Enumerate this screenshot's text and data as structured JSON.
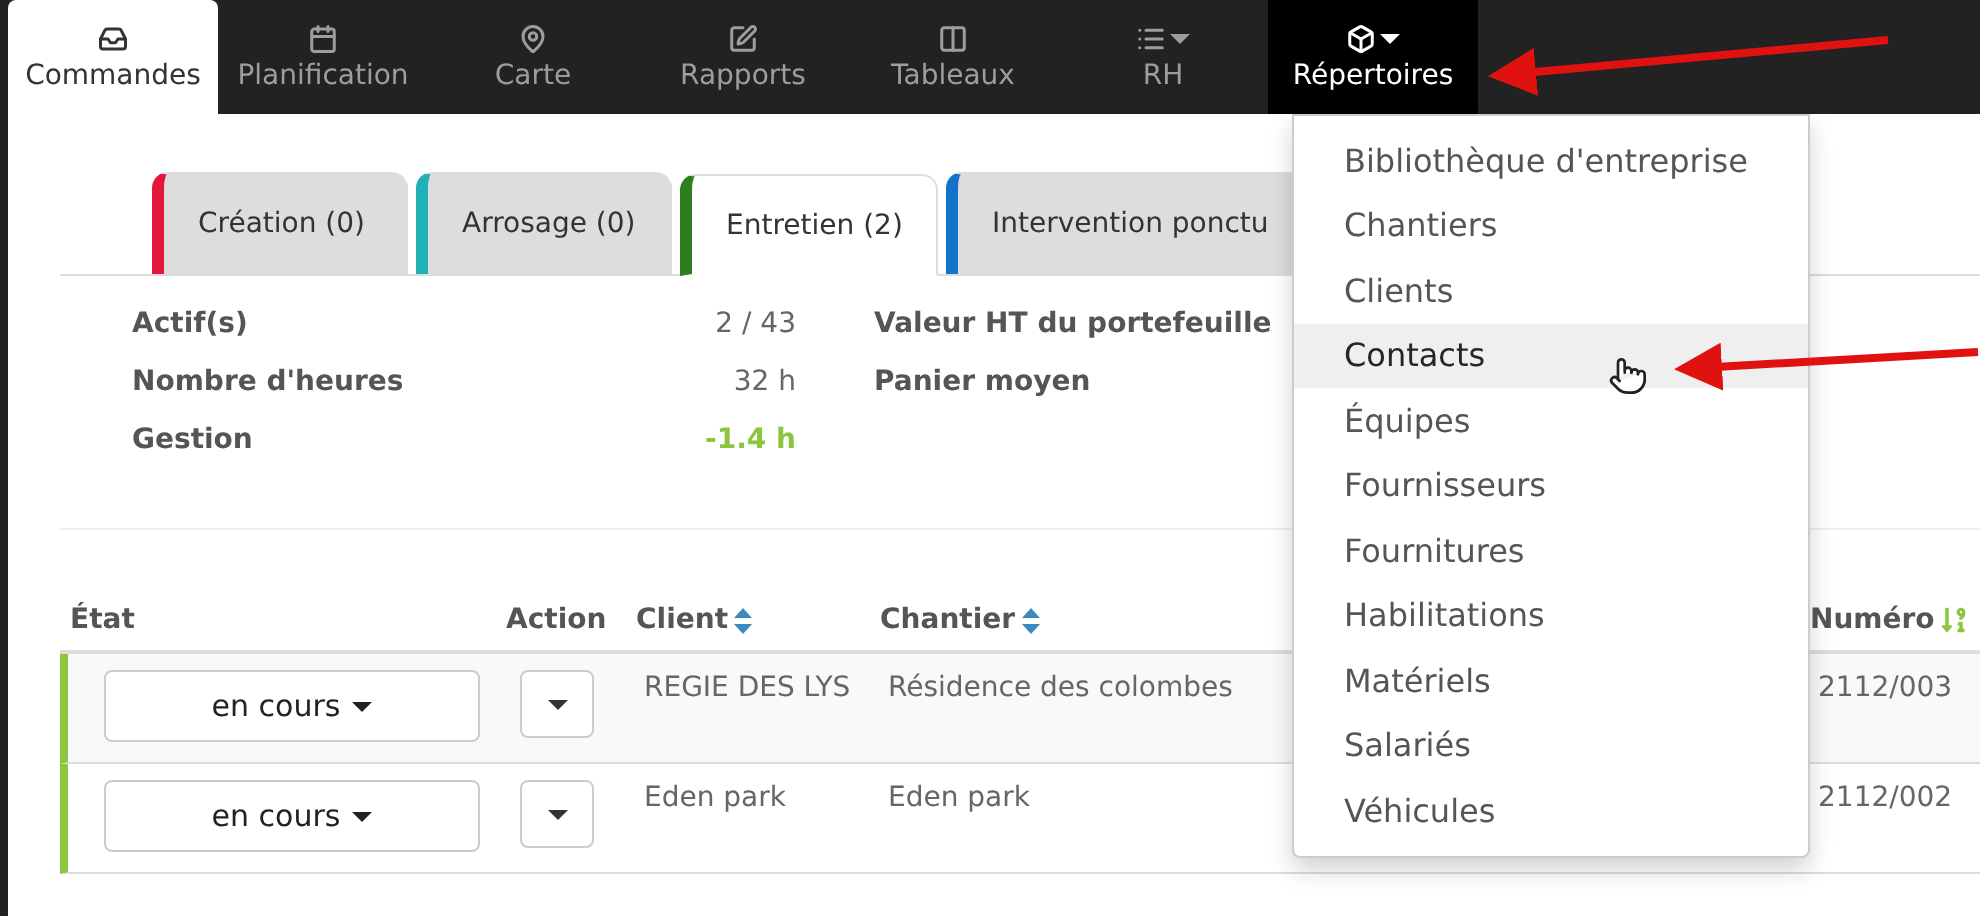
{
  "nav": {
    "items": [
      {
        "label": "Commandes",
        "selected": true,
        "dropdown": false,
        "open": false
      },
      {
        "label": "Planification",
        "selected": false,
        "dropdown": false,
        "open": false
      },
      {
        "label": "Carte",
        "selected": false,
        "dropdown": false,
        "open": false
      },
      {
        "label": "Rapports",
        "selected": false,
        "dropdown": false,
        "open": false
      },
      {
        "label": "Tableaux",
        "selected": false,
        "dropdown": false,
        "open": false
      },
      {
        "label": "RH",
        "selected": false,
        "dropdown": true,
        "open": false
      },
      {
        "label": "Répertoires",
        "selected": false,
        "dropdown": true,
        "open": true
      }
    ]
  },
  "tabs": [
    {
      "label": "Création (0)",
      "color": "#e4173a",
      "selected": false
    },
    {
      "label": "Arrosage (0)",
      "color": "#1fb0b8",
      "selected": false
    },
    {
      "label": "Entretien (2)",
      "color": "#2e7d1e",
      "selected": true
    },
    {
      "label": "Intervention ponctu",
      "color": "#1372c9",
      "selected": false
    }
  ],
  "stats": {
    "left": [
      {
        "label": "Actif(s)",
        "value": "2 / 43",
        "highlight": false
      },
      {
        "label": "Nombre d'heures",
        "value": "32 h",
        "highlight": false
      },
      {
        "label": "Gestion",
        "value": "-1.4 h",
        "highlight": true
      }
    ],
    "right": [
      {
        "label": "Valeur HT du portefeuille"
      },
      {
        "label": "Panier moyen"
      }
    ]
  },
  "table": {
    "columns": [
      {
        "label": "État",
        "kind": "plain"
      },
      {
        "label": "Action",
        "kind": "plain"
      },
      {
        "label": "Client",
        "kind": "sortable"
      },
      {
        "label": "Chantier",
        "kind": "sortable"
      },
      {
        "label": "Numéro",
        "kind": "sorted"
      }
    ],
    "rows": [
      {
        "status": "en cours",
        "client": "REGIE DES LYS",
        "chantier": "Résidence des colombes",
        "numero": "2112/003"
      },
      {
        "status": "en cours",
        "client": "Eden park",
        "chantier": "Eden park",
        "numero": "2112/002"
      }
    ]
  },
  "menu": {
    "items": [
      {
        "label": "Bibliothèque d'entreprise",
        "hovered": false
      },
      {
        "label": "Chantiers",
        "hovered": false
      },
      {
        "label": "Clients",
        "hovered": false
      },
      {
        "label": "Contacts",
        "hovered": true
      },
      {
        "label": "Équipes",
        "hovered": false
      },
      {
        "label": "Fournisseurs",
        "hovered": false
      },
      {
        "label": "Fournitures",
        "hovered": false
      },
      {
        "label": "Habilitations",
        "hovered": false
      },
      {
        "label": "Matériels",
        "hovered": false
      },
      {
        "label": "Salariés",
        "hovered": false
      },
      {
        "label": "Véhicules",
        "hovered": false
      }
    ]
  }
}
